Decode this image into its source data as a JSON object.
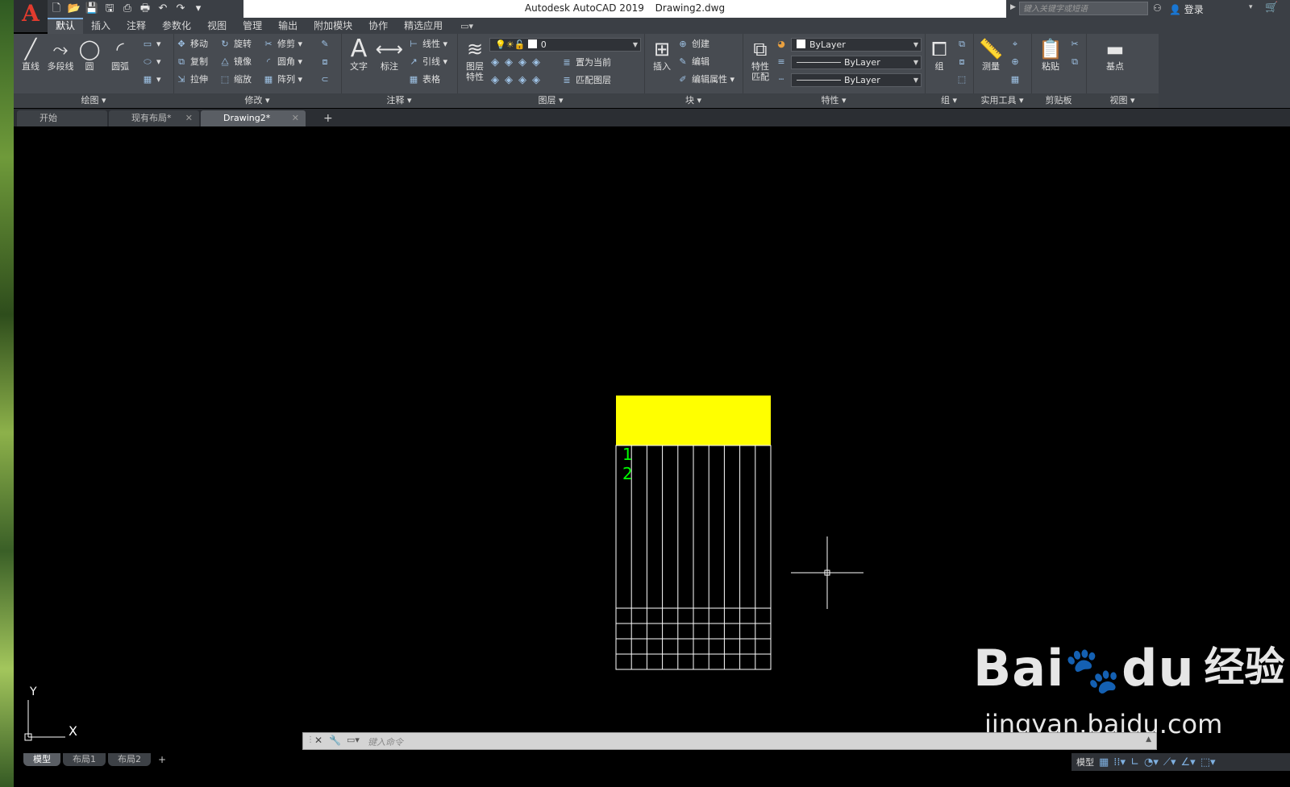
{
  "title": {
    "app": "Autodesk AutoCAD 2019",
    "file": "Drawing2.dwg"
  },
  "search": {
    "placeholder": "键入关键字或短语"
  },
  "user": {
    "login": "登录"
  },
  "menu_tabs": [
    "默认",
    "插入",
    "注释",
    "参数化",
    "视图",
    "管理",
    "输出",
    "附加模块",
    "协作",
    "精选应用"
  ],
  "ribbon": {
    "draw": {
      "title": "绘图 ▾",
      "line": "直线",
      "polyline": "多段线",
      "circle": "圆",
      "arc": "圆弧"
    },
    "modify": {
      "title": "修改 ▾",
      "move": "移动",
      "rotate": "旋转",
      "trim": "修剪",
      "copy": "复制",
      "mirror": "镜像",
      "fillet": "圆角",
      "stretch": "拉伸",
      "scale": "缩放",
      "array": "阵列"
    },
    "annotation": {
      "title": "注释 ▾",
      "text": "文字",
      "dimension": "标注",
      "linear": "线性",
      "leader": "引线",
      "table": "表格"
    },
    "layers": {
      "title": "图层 ▾",
      "properties": "图层\n特性",
      "current_layer": "0",
      "set_current": "置为当前",
      "match_layer": "匹配图层"
    },
    "block": {
      "title": "块 ▾",
      "insert": "插入",
      "create": "创建",
      "edit": "编辑",
      "edit_attributes": "编辑属性"
    },
    "properties": {
      "title": "特性 ▾",
      "match": "特性\n匹配",
      "color": "ByLayer",
      "linetype": "ByLayer",
      "lineweight": "ByLayer"
    },
    "groups": {
      "title": "组 ▾",
      "group": "组"
    },
    "utilities": {
      "title": "实用工具 ▾",
      "measure": "测量"
    },
    "clipboard": {
      "title": "剪贴板",
      "paste": "粘贴"
    },
    "view": {
      "title": "视图 ▾",
      "base": "基点"
    }
  },
  "file_tabs": [
    {
      "label": "开始"
    },
    {
      "label": "现有布局*"
    },
    {
      "label": "Drawing2*"
    }
  ],
  "table_drawing": {
    "header_color": "#ffff00",
    "line_color": "#ffffff",
    "row_number_color": "#00ff00",
    "row_numbers": [
      "1",
      "2"
    ],
    "columns": 10,
    "bottom_grid_rows": 4
  },
  "ucs": {
    "x": "X",
    "y": "Y"
  },
  "command": {
    "placeholder": "键入命令"
  },
  "watermark": {
    "main": "Bai",
    "paw": "du",
    "cn": "经验",
    "url": "jingyan.baidu.com"
  },
  "layout_tabs": [
    "模型",
    "布局1",
    "布局2"
  ],
  "status": {
    "model": "模型"
  }
}
